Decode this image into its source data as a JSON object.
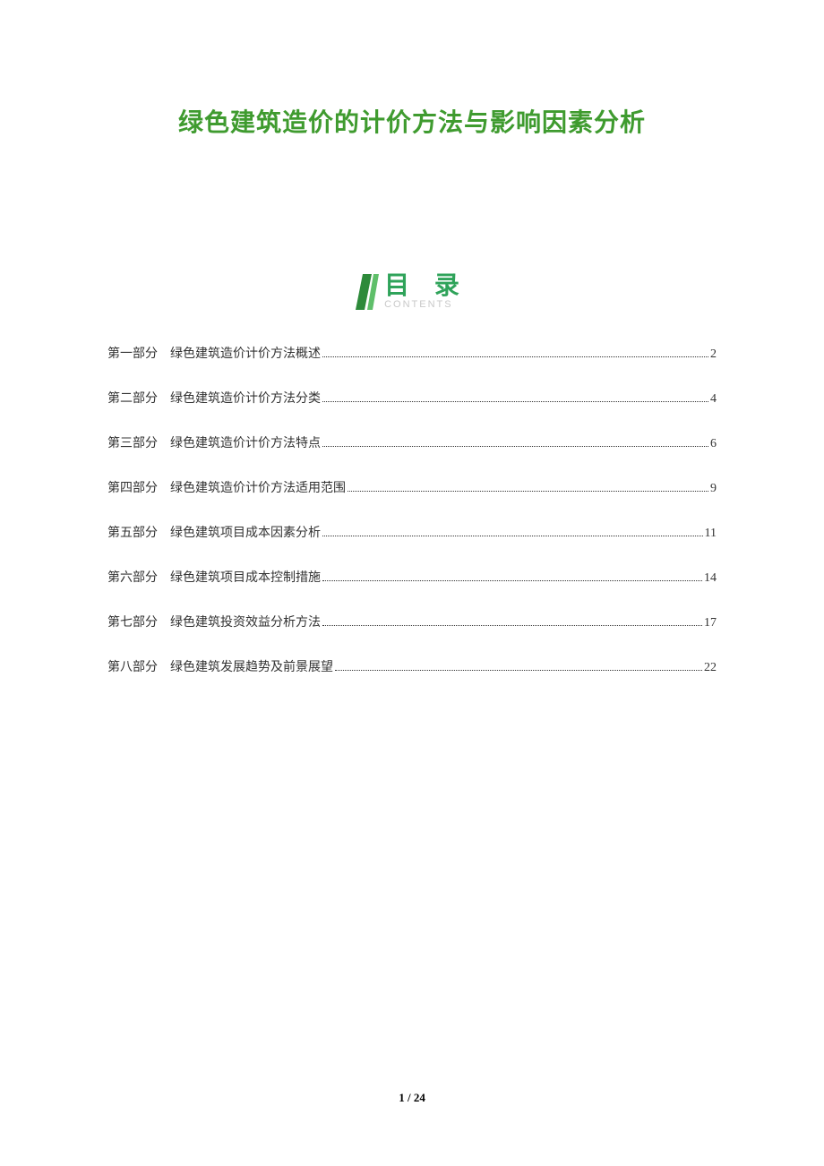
{
  "title": "绿色建筑造价的计价方法与影响因素分析",
  "toc_header": {
    "main": "目 录",
    "sub": "CONTENTS"
  },
  "toc": [
    {
      "part": "第一部分",
      "title": "绿色建筑造价计价方法概述",
      "page": "2"
    },
    {
      "part": "第二部分",
      "title": "绿色建筑造价计价方法分类",
      "page": "4"
    },
    {
      "part": "第三部分",
      "title": "绿色建筑造价计价方法特点",
      "page": "6"
    },
    {
      "part": "第四部分",
      "title": "绿色建筑造价计价方法适用范围",
      "page": "9"
    },
    {
      "part": "第五部分",
      "title": "绿色建筑项目成本因素分析",
      "page": "11"
    },
    {
      "part": "第六部分",
      "title": "绿色建筑项目成本控制措施",
      "page": "14"
    },
    {
      "part": "第七部分",
      "title": "绿色建筑投资效益分析方法",
      "page": "17"
    },
    {
      "part": "第八部分",
      "title": "绿色建筑发展趋势及前景展望",
      "page": "22"
    }
  ],
  "footer": {
    "current": "1",
    "sep": " / ",
    "total": "24"
  },
  "colors": {
    "title_green": "#3f9b2f",
    "toc_green": "#2fa35a",
    "sub_gray": "#c9c9c9",
    "text": "#333333"
  }
}
